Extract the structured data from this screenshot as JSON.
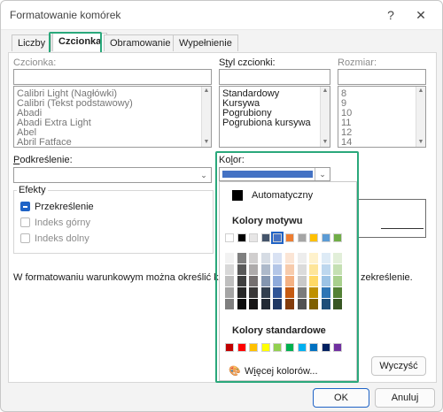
{
  "window": {
    "title": "Formatowanie komórek",
    "help_glyph": "?",
    "close_glyph": "✕"
  },
  "tabs": [
    {
      "label": "Liczby"
    },
    {
      "label": "Czcionka"
    },
    {
      "label": "Obramowanie"
    },
    {
      "label": "Wypełnienie"
    }
  ],
  "font": {
    "label": "Czcionka:",
    "value": "",
    "list": [
      "Calibri Light (Nagłówki)",
      "Calibri (Tekst podstawowy)",
      "Abadi",
      "Abadi Extra Light",
      "Abel",
      "Abril Fatface"
    ]
  },
  "style": {
    "label_pre": "S",
    "label_u": "t",
    "label_post": "yl czcionki:",
    "value": "",
    "list": [
      "Standardowy",
      "Kursywa",
      "Pogrubiony",
      "Pogrubiona kursywa"
    ]
  },
  "size": {
    "label": "Rozmiar:",
    "value": "",
    "list": [
      "8",
      "9",
      "10",
      "11",
      "12",
      "14"
    ]
  },
  "underline": {
    "label_u": "P",
    "label_post": "odkreślenie:",
    "value": ""
  },
  "color": {
    "label_pre": "Ko",
    "label_u": "l",
    "label_post": "or:",
    "selected_hex": "#4472c4"
  },
  "effects": {
    "title": "Efekty",
    "items": [
      {
        "label": "Przekreślenie",
        "checked": true,
        "enabled": true
      },
      {
        "label": "Indeks górny",
        "checked": false,
        "enabled": false
      },
      {
        "label": "Indeks dolny",
        "checked": false,
        "enabled": false
      }
    ]
  },
  "info_text": "W formatowaniu warunkowym można określić kr",
  "info_text_tail": "zekreślenie.",
  "color_popup": {
    "automatic_label": "Automatyczny",
    "theme_title": "Kolory motywu",
    "theme_top": [
      "#ffffff",
      "#000000",
      "#e7e6e6",
      "#44546a",
      "#4472c4",
      "#ed7d31",
      "#a5a5a5",
      "#ffc000",
      "#5b9bd5",
      "#70ad47"
    ],
    "theme_shades": [
      [
        "#f2f2f2",
        "#7f7f7f",
        "#d0cece",
        "#d6dce4",
        "#d9e2f3",
        "#fbe5d5",
        "#ededed",
        "#fff2cc",
        "#deebf6",
        "#e2efd9"
      ],
      [
        "#d8d8d8",
        "#595959",
        "#aeabab",
        "#adb9ca",
        "#b4c6e7",
        "#f7cbac",
        "#dbdbdb",
        "#fee599",
        "#bdd7ee",
        "#c5e0b3"
      ],
      [
        "#bfbfbf",
        "#3f3f3f",
        "#757070",
        "#8496b0",
        "#8eaadb",
        "#f4b183",
        "#c9c9c9",
        "#ffd965",
        "#9cc3e5",
        "#a8d08d"
      ],
      [
        "#a5a5a5",
        "#262626",
        "#3a3838",
        "#323f4f",
        "#2f5496",
        "#c55a11",
        "#7b7b7b",
        "#bf9000",
        "#2e75b5",
        "#538135"
      ],
      [
        "#7f7f7f",
        "#0c0c0c",
        "#171616",
        "#222a35",
        "#1f3864",
        "#833c0b",
        "#525252",
        "#7f6000",
        "#1e4e79",
        "#375623"
      ]
    ],
    "standard_title": "Kolory standardowe",
    "standard": [
      "#c00000",
      "#ff0000",
      "#ffc000",
      "#ffff00",
      "#92d050",
      "#00b050",
      "#00b0f0",
      "#0070c0",
      "#002060",
      "#7030a0"
    ],
    "more_pre": "W",
    "more_u": "i",
    "more_post": "ęcej kolorów..."
  },
  "buttons": {
    "clear": "Wyczyść",
    "ok": "OK",
    "cancel": "Anuluj"
  }
}
